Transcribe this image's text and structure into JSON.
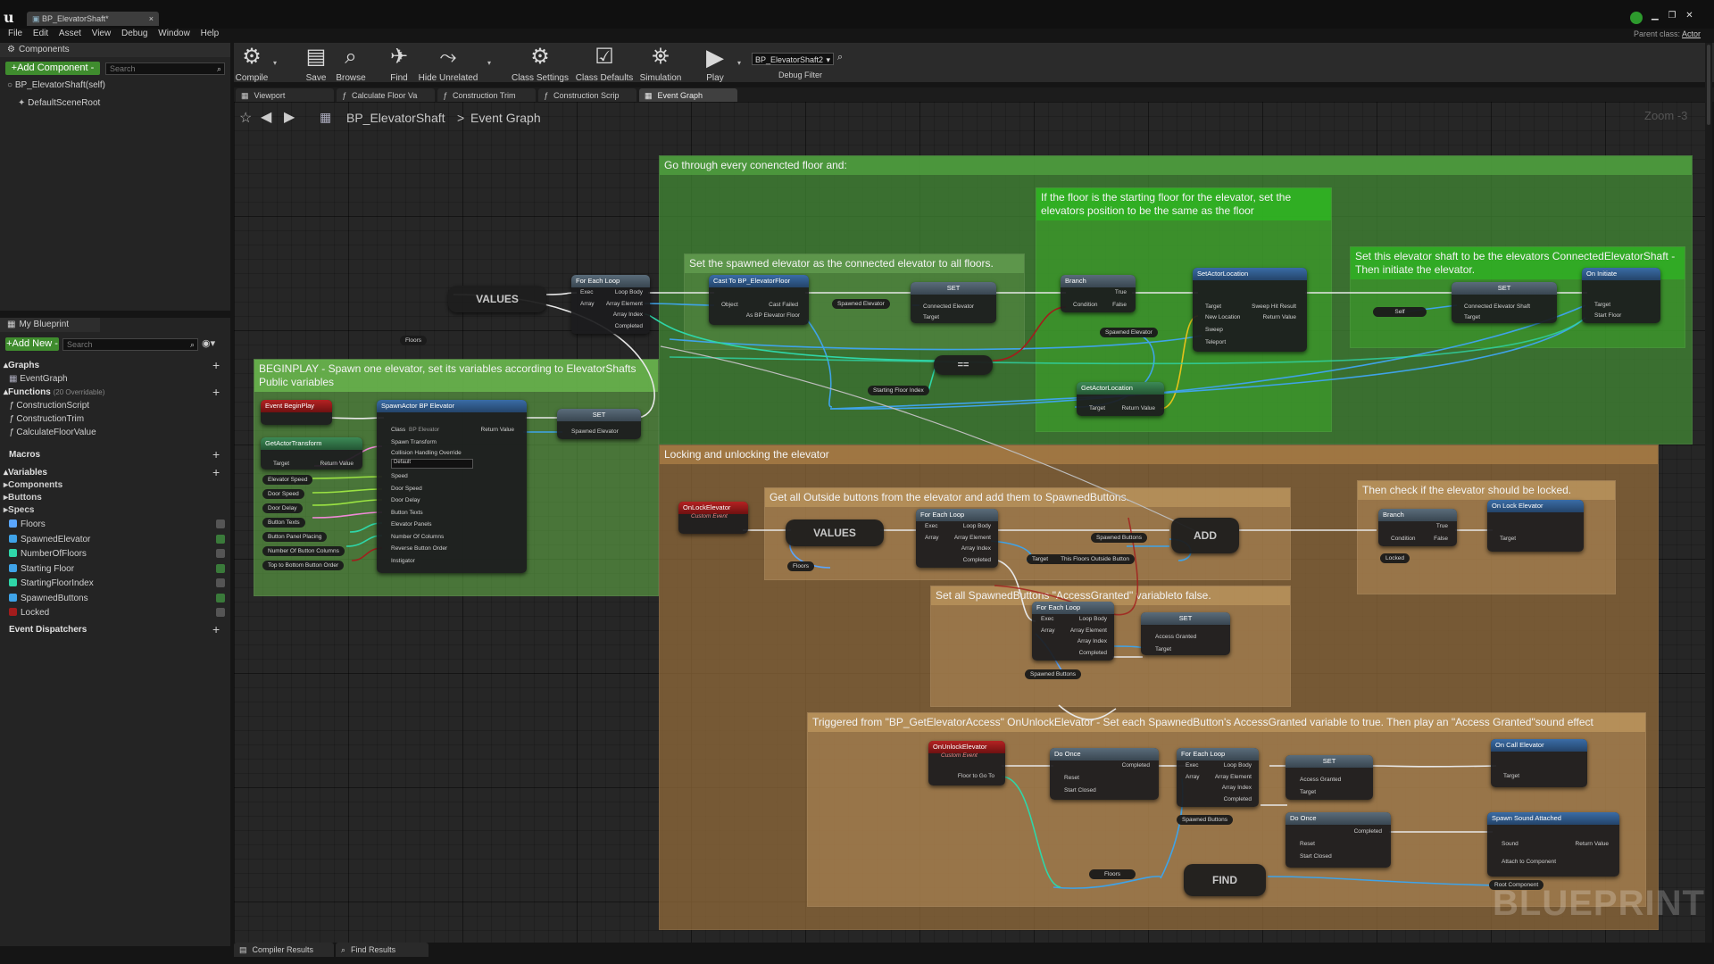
{
  "window": {
    "tab_title": "BP_ElevatorShaft*",
    "parent_class_label": "Parent class:",
    "parent_class_value": "Actor"
  },
  "menu": [
    "File",
    "Edit",
    "Asset",
    "View",
    "Debug",
    "Window",
    "Help"
  ],
  "components_panel": {
    "tab_label": "Components",
    "add_button": "+Add Component -",
    "search_placeholder": "Search",
    "items": [
      "BP_ElevatorShaft(self)",
      "DefaultSceneRoot"
    ]
  },
  "toolbar": {
    "buttons": [
      "Compile",
      "Save",
      "Browse",
      "Find",
      "Hide Unrelated",
      "Class Settings",
      "Class Defaults",
      "Simulation",
      "Play"
    ],
    "debug_object": "BP_ElevatorShaft2",
    "debug_filter_label": "Debug Filter"
  },
  "editor_tabs": [
    "Viewport",
    "Calculate Floor Va",
    "Construction Trim",
    "Construction Scrip",
    "Event Graph"
  ],
  "breadcrumb": {
    "root": "BP_ElevatorShaft",
    "separator": ">",
    "current": "Event Graph"
  },
  "zoom_label": "Zoom -3",
  "my_blueprint": {
    "tab_label": "My Blueprint",
    "add_button": "+Add New -",
    "search_placeholder": "Search",
    "graphs_header": "Graphs",
    "graphs": [
      "EventGraph"
    ],
    "functions_header": "Functions",
    "functions_count": "(20 Overridable)",
    "functions": [
      "ConstructionScript",
      "ConstructionTrim",
      "CalculateFloorValue"
    ],
    "macros_header": "Macros",
    "variables_header": "Variables",
    "variable_groups": [
      "Components",
      "Buttons",
      "Specs"
    ],
    "variables": [
      {
        "name": "Floors",
        "color": "#5aa6ff"
      },
      {
        "name": "SpawnedElevator",
        "color": "#3fa3e8"
      },
      {
        "name": "NumberOfFloors",
        "color": "#2fd6a8"
      },
      {
        "name": "Starting Floor",
        "color": "#3fa3e8"
      },
      {
        "name": "StartingFloorIndex",
        "color": "#2fd6a8"
      },
      {
        "name": "SpawnedButtons",
        "color": "#3fa3e8"
      },
      {
        "name": "Locked",
        "color": "#a31c1c"
      }
    ],
    "dispatchers_header": "Event Dispatchers"
  },
  "comments": {
    "main": "Go through every conencted floor and:",
    "starting_floor": "If the floor is the starting floor for the elevator, set the elevators position to be the same as the floor",
    "set_connected": "Set the spawned elevator as the connected elevator to all floors.",
    "initiate": "Set this elevator shaft to be the elevators ConnectedElevatorShaft - Then initiate the elevator.",
    "beginplay": "BEGINPLAY - Spawn one elevator, set its variables according to ElevatorShafts Public variables",
    "locking": "Locking and unlocking the elevator",
    "outside_buttons": "Get all Outside buttons from the elevator and add them to SpawnedButtons.",
    "check_locked": "Then check if the elevator should be locked.",
    "access_false": "Set all SpawnedButtons \"AccessGranted\" variableto false.",
    "triggered": "Triggered from \"BP_GetElevatorAccess\" OnUnlockElevator - Set each SpawnedButton's AccessGranted variable to true. Then play an \"Access Granted\"sound effect"
  },
  "nodes": {
    "values": "VALUES",
    "floors": "Floors",
    "for_each_loop": "For Each Loop",
    "exec": "Exec",
    "loop_body": "Loop Body",
    "array": "Array",
    "array_element": "Array Element",
    "array_index": "Array Index",
    "completed": "Completed",
    "cast": "Cast To BP_ElevatorFloor",
    "object": "Object",
    "cast_failed": "Cast Failed",
    "as_floor": "As BP Elevator Floor",
    "spawned_elevator": "Spawned Elevator",
    "set": "SET",
    "connected_elevator": "Connected Elevator",
    "target": "Target",
    "equals": "==",
    "starting_floor_index": "Starting Floor Index",
    "branch": "Branch",
    "condition": "Condition",
    "true_pin": "True",
    "false_pin": "False",
    "set_actor_location": "SetActorLocation",
    "new_location": "New Location",
    "sweep": "Sweep",
    "teleport": "Teleport",
    "sweep_hit": "Sweep Hit Result",
    "return_value": "Return Value",
    "get_actor_location": "GetActorLocation",
    "self": "Self",
    "connected_shaft": "Connected Elevator Shaft",
    "on_initiate": "On Initiate",
    "start_floor": "Start Floor",
    "event_beginplay": "Event BeginPlay",
    "get_actor_transform": "GetActorTransform",
    "spawn_actor": "SpawnActor BP Elevator",
    "class": "Class",
    "class_value": "BP Elevator",
    "spawn_transform": "Spawn Transform",
    "collision": "Collision Handling Override",
    "collision_value": "Default",
    "spawn_pins": [
      "Speed",
      "Door Speed",
      "Door Delay",
      "Button Texts",
      "Elevator Panels",
      "Number Of Columns",
      "Reverse Button Order",
      "Instigator"
    ],
    "var_pins": [
      "Elevator Speed",
      "Door Speed",
      "Door Delay",
      "Button Texts",
      "Button Panel Placing",
      "Number Of Button Columns",
      "Top to Bottom Button Order"
    ],
    "on_lock_elevator": "OnLockElevator",
    "custom_event": "Custom Event",
    "add": "ADD",
    "spawned_buttons": "Spawned Buttons",
    "this_floors_buttons": "This Floors Outside Button",
    "locked": "Locked",
    "on_lock_elevator_call": "On Lock Elevator",
    "access_granted": "Access Granted",
    "on_unlock_elevator": "OnUnlockElevator",
    "floor_to_go_to": "Floor to Go To",
    "do_once": "Do Once",
    "reset": "Reset",
    "start_closed": "Start Closed",
    "on_call_elevator": "On Call Elevator",
    "spawn_sound": "Spawn Sound Attached",
    "sound": "Sound",
    "attach_to": "Attach to Component",
    "root_component": "Root Component",
    "find": "FIND"
  },
  "bottom_tabs": [
    "Compiler Results",
    "Find Results"
  ],
  "watermark": "BLUEPRINT"
}
